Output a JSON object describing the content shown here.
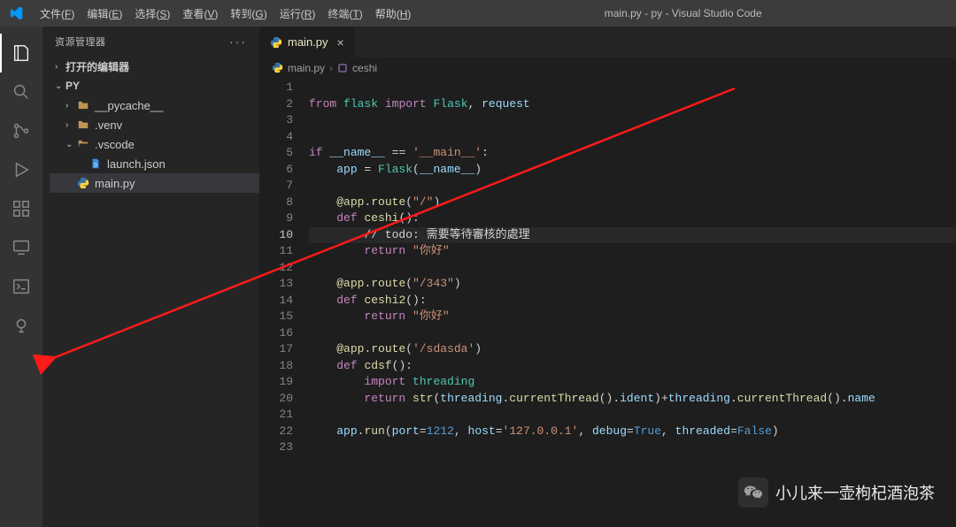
{
  "title_bar": {
    "app_title": "main.py - py - Visual Studio Code",
    "menus": [
      {
        "label": "文件",
        "mn": "F"
      },
      {
        "label": "编辑",
        "mn": "E"
      },
      {
        "label": "选择",
        "mn": "S"
      },
      {
        "label": "查看",
        "mn": "V"
      },
      {
        "label": "转到",
        "mn": "G"
      },
      {
        "label": "运行",
        "mn": "R"
      },
      {
        "label": "终端",
        "mn": "T"
      },
      {
        "label": "帮助",
        "mn": "H"
      }
    ]
  },
  "sidebar": {
    "header": "资源管理器",
    "open_editors": "打开的编辑器",
    "root": "PY",
    "items": [
      {
        "name": "__pycache__",
        "type": "folder",
        "collapsed": true
      },
      {
        "name": ".venv",
        "type": "folder",
        "collapsed": true
      },
      {
        "name": ".vscode",
        "type": "folder",
        "collapsed": false
      },
      {
        "name": "launch.json",
        "type": "json",
        "parent": ".vscode"
      },
      {
        "name": "main.py",
        "type": "py",
        "active": true
      }
    ]
  },
  "tabs": {
    "main": {
      "label": "main.py"
    }
  },
  "breadcrumb": {
    "file": "main.py",
    "symbol": "ceshi"
  },
  "code": {
    "current_line": 10,
    "lines": [
      {
        "n": 1,
        "seg": []
      },
      {
        "n": 2,
        "seg": [
          [
            "kw",
            "from"
          ],
          [
            "op",
            " "
          ],
          [
            "mod",
            "flask"
          ],
          [
            "op",
            " "
          ],
          [
            "kw",
            "import"
          ],
          [
            "op",
            " "
          ],
          [
            "mod",
            "Flask"
          ],
          [
            "op",
            ", "
          ],
          [
            "var",
            "request"
          ]
        ]
      },
      {
        "n": 3,
        "seg": []
      },
      {
        "n": 4,
        "seg": []
      },
      {
        "n": 5,
        "seg": [
          [
            "kw",
            "if"
          ],
          [
            "op",
            " "
          ],
          [
            "var",
            "__name__"
          ],
          [
            "op",
            " == "
          ],
          [
            "str",
            "'__main__'"
          ],
          [
            "op",
            ":"
          ]
        ]
      },
      {
        "n": 6,
        "seg": [
          [
            "op",
            "    "
          ],
          [
            "var",
            "app"
          ],
          [
            "op",
            " = "
          ],
          [
            "mod",
            "Flask"
          ],
          [
            "op",
            "("
          ],
          [
            "var",
            "__name__"
          ],
          [
            "op",
            ")"
          ]
        ]
      },
      {
        "n": 7,
        "seg": []
      },
      {
        "n": 8,
        "seg": [
          [
            "op",
            "    "
          ],
          [
            "dec",
            "@app"
          ],
          [
            "op",
            "."
          ],
          [
            "fn",
            "route"
          ],
          [
            "op",
            "("
          ],
          [
            "str",
            "\"/\""
          ],
          [
            "op",
            ")"
          ]
        ]
      },
      {
        "n": 9,
        "seg": [
          [
            "op",
            "    "
          ],
          [
            "kw",
            "def"
          ],
          [
            "op",
            " "
          ],
          [
            "fn",
            "ceshi"
          ],
          [
            "op",
            "():"
          ]
        ]
      },
      {
        "n": 10,
        "seg": [
          [
            "op",
            "        "
          ],
          [
            "cmt",
            "// todo: 需要等待審核的處理"
          ]
        ]
      },
      {
        "n": 11,
        "seg": [
          [
            "op",
            "        "
          ],
          [
            "kw",
            "return"
          ],
          [
            "op",
            " "
          ],
          [
            "str",
            "\"你好\""
          ]
        ]
      },
      {
        "n": 12,
        "seg": []
      },
      {
        "n": 13,
        "seg": [
          [
            "op",
            "    "
          ],
          [
            "dec",
            "@app"
          ],
          [
            "op",
            "."
          ],
          [
            "fn",
            "route"
          ],
          [
            "op",
            "("
          ],
          [
            "str",
            "\"/343\""
          ],
          [
            "op",
            ")"
          ]
        ]
      },
      {
        "n": 14,
        "seg": [
          [
            "op",
            "    "
          ],
          [
            "kw",
            "def"
          ],
          [
            "op",
            " "
          ],
          [
            "fn",
            "ceshi2"
          ],
          [
            "op",
            "():"
          ]
        ]
      },
      {
        "n": 15,
        "seg": [
          [
            "op",
            "        "
          ],
          [
            "kw",
            "return"
          ],
          [
            "op",
            " "
          ],
          [
            "str",
            "\"你好\""
          ]
        ]
      },
      {
        "n": 16,
        "seg": []
      },
      {
        "n": 17,
        "seg": [
          [
            "op",
            "    "
          ],
          [
            "dec",
            "@app"
          ],
          [
            "op",
            "."
          ],
          [
            "fn",
            "route"
          ],
          [
            "op",
            "("
          ],
          [
            "str",
            "'/sdasda'"
          ],
          [
            "op",
            ")"
          ]
        ]
      },
      {
        "n": 18,
        "seg": [
          [
            "op",
            "    "
          ],
          [
            "kw",
            "def"
          ],
          [
            "op",
            " "
          ],
          [
            "fn",
            "cdsf"
          ],
          [
            "op",
            "():"
          ]
        ]
      },
      {
        "n": 19,
        "seg": [
          [
            "op",
            "        "
          ],
          [
            "kw",
            "import"
          ],
          [
            "op",
            " "
          ],
          [
            "mod",
            "threading"
          ]
        ]
      },
      {
        "n": 20,
        "seg": [
          [
            "op",
            "        "
          ],
          [
            "kw",
            "return"
          ],
          [
            "op",
            " "
          ],
          [
            "fn",
            "str"
          ],
          [
            "op",
            "("
          ],
          [
            "var",
            "threading"
          ],
          [
            "op",
            "."
          ],
          [
            "fn",
            "currentThread"
          ],
          [
            "op",
            "()."
          ],
          [
            "var",
            "ident"
          ],
          [
            "op",
            ")+"
          ],
          [
            "var",
            "threading"
          ],
          [
            "op",
            "."
          ],
          [
            "fn",
            "currentThread"
          ],
          [
            "op",
            "()."
          ],
          [
            "var",
            "name"
          ]
        ]
      },
      {
        "n": 21,
        "seg": []
      },
      {
        "n": 22,
        "seg": [
          [
            "op",
            "    "
          ],
          [
            "var",
            "app"
          ],
          [
            "op",
            "."
          ],
          [
            "fn",
            "run"
          ],
          [
            "op",
            "("
          ],
          [
            "var",
            "port"
          ],
          [
            "op",
            "="
          ],
          [
            "const",
            "1212"
          ],
          [
            "op",
            ", "
          ],
          [
            "var",
            "host"
          ],
          [
            "op",
            "="
          ],
          [
            "str",
            "'127.0.0.1'"
          ],
          [
            "op",
            ", "
          ],
          [
            "var",
            "debug"
          ],
          [
            "op",
            "="
          ],
          [
            "const",
            "True"
          ],
          [
            "op",
            ", "
          ],
          [
            "var",
            "threaded"
          ],
          [
            "op",
            "="
          ],
          [
            "const",
            "False"
          ],
          [
            "op",
            ")"
          ]
        ]
      },
      {
        "n": 23,
        "seg": []
      }
    ]
  },
  "watermark": {
    "text": "小儿来一壶枸杞酒泡茶"
  }
}
